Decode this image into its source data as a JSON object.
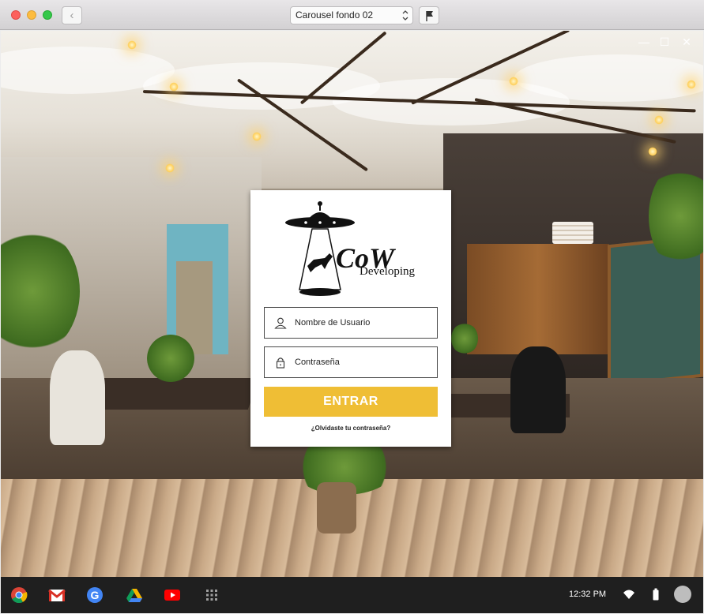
{
  "window": {
    "title": "Carousel fondo 02"
  },
  "toolbar": {
    "back_symbol": "‹",
    "doc_updown_icon": "updown-chevron-icon",
    "flag_icon": "flag-icon"
  },
  "screen_controls": {
    "minimize": "—",
    "maximize": "☐",
    "close": "✕"
  },
  "login": {
    "brand_name": "CoW",
    "brand_tagline": "Developing",
    "username_placeholder": "Nombre de Usuario",
    "password_placeholder": "Contraseña",
    "submit_label": "ENTRAR",
    "forgot_link": "¿Olvidaste tu contraseña?",
    "accent_color": "#efbe35"
  },
  "shelf": {
    "apps": [
      {
        "name": "Chrome",
        "icon": "chrome-icon"
      },
      {
        "name": "Gmail",
        "icon": "gmail-icon"
      },
      {
        "name": "Google",
        "icon": "google-icon"
      },
      {
        "name": "Drive",
        "icon": "drive-icon"
      },
      {
        "name": "YouTube",
        "icon": "youtube-icon"
      },
      {
        "name": "Launcher",
        "icon": "apps-grid-icon"
      }
    ],
    "clock": "12:32 PM",
    "tray_icons": [
      "wifi-icon",
      "battery-icon",
      "avatar"
    ]
  }
}
